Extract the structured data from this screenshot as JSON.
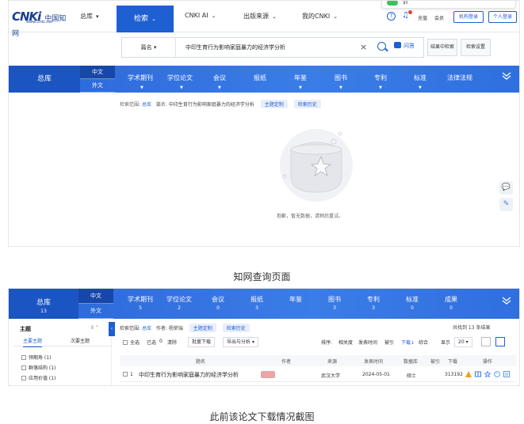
{
  "shot1": {
    "logo": {
      "mark": "CNKi",
      "cn": "中国知网",
      "url": "www.cnki.net"
    },
    "nav": {
      "zongku": "总库",
      "search": "检索",
      "cnki_ai": "CNKI AI",
      "publication": "出版来源",
      "my_cnki": "我的CNKI"
    },
    "popover_text": "训",
    "top_right": {
      "recharge": "充值",
      "member": "会员",
      "org_login": "机构登录",
      "personal_login": "个人登录"
    },
    "search": {
      "field": "篇名",
      "query": "中印生育行为影响家庭暴力的经济学分析",
      "ask": "问答",
      "in_results": "结果中检索",
      "settings": "检索设置"
    },
    "categories": {
      "zongku": "总库",
      "lang_cn": "中文",
      "lang_foreign": "外文",
      "items": [
        "学术期刊",
        "学位论文",
        "会议",
        "报纸",
        "年鉴",
        "图书",
        "专利",
        "标准",
        "法律法规"
      ]
    },
    "range": {
      "label": "检索范围:",
      "db": "总库",
      "field": "篇名:",
      "query": "中印生育行为影响家庭暴力的经济学分析",
      "subscribe": "主题定制",
      "history": "检索历史"
    },
    "empty_text": "抱歉，暂无数据，请稍后重试。"
  },
  "caption1": "知网查询页面",
  "shot2": {
    "zongku": {
      "label": "总库",
      "count": "13"
    },
    "lang_cn": "中文",
    "lang_foreign": "外文",
    "categories": [
      {
        "label": "学术期刊",
        "count": "5"
      },
      {
        "label": "学位论文",
        "count": "2"
      },
      {
        "label": "会议",
        "count": "0"
      },
      {
        "label": "报纸",
        "count": "3"
      },
      {
        "label": "年鉴",
        "count": ""
      },
      {
        "label": "图书",
        "count": "3"
      },
      {
        "label": "专利",
        "count": "3"
      },
      {
        "label": "标准",
        "count": "0"
      },
      {
        "label": "成果",
        "count": "0"
      }
    ],
    "left": {
      "title": "主题",
      "tab_main": "主要主题",
      "tab_sub": "次要主题",
      "items": [
        "预期寿 (1)",
        "群落结构 (1)",
        "应用价值 (1)"
      ]
    },
    "range": {
      "label": "检索范围:",
      "db": "总库",
      "author_label": "作者:",
      "author": "杨荣瑞",
      "subscribe": "主题定制",
      "history": "检索历史"
    },
    "total": "共找到 13 条结果",
    "toolbar": {
      "select_all": "全选",
      "selected": "已选",
      "selected_count": "0",
      "clear": "清除",
      "batch_download": "批量下载",
      "export": "导出与分析",
      "sort_label": "排序:",
      "sort_relevance": "相关度",
      "sort_date": "发表时间",
      "sort_cited": "被引",
      "sort_download": "下载",
      "sort_overall": "综合",
      "show_label": "显示",
      "show_value": "20"
    },
    "table": {
      "headers": [
        "题名",
        "作者",
        "来源",
        "发表时间",
        "数据库",
        "被引",
        "下载",
        "操作"
      ],
      "row": {
        "index": "1",
        "title": "中印生育行为影响家庭暴力的经济学分析",
        "source": "武汉大学",
        "date": "2024-05-01",
        "db": "硕士",
        "cited": "",
        "downloads": "313192"
      }
    }
  },
  "caption2": "此前该论文下载情况截图"
}
